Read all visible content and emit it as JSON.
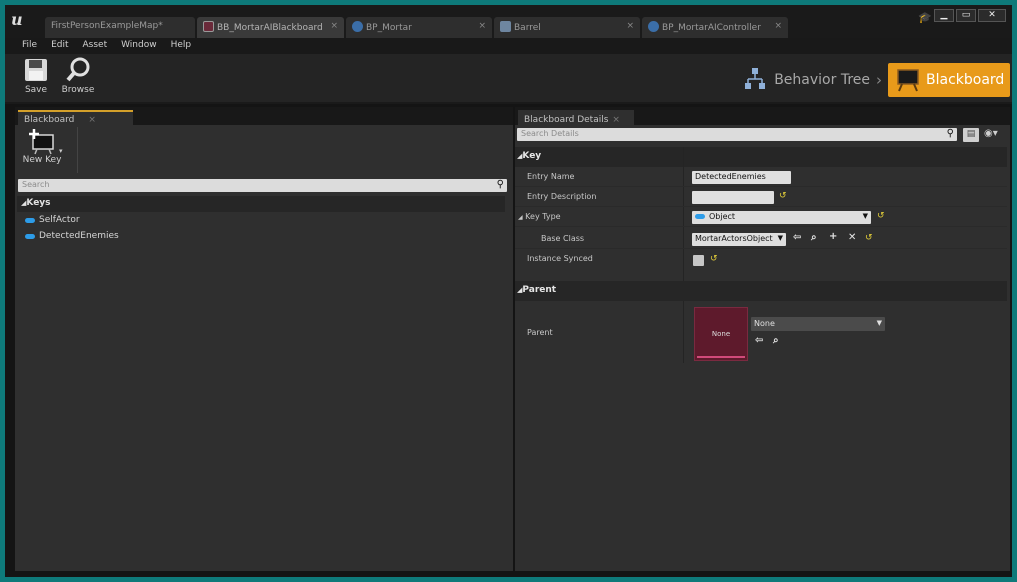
{
  "colors": {
    "accent": "#e89a1a",
    "window_border": "#0e7a7a",
    "key_pill": "#2d9ce8",
    "reset_arrow": "#e6d13a"
  },
  "titlebar": {
    "logo_icon": "unreal-engine-logo",
    "tabs": [
      {
        "label": "FirstPersonExampleMap",
        "dirty": "*",
        "icon": ""
      },
      {
        "label": "BB_MortarAIBlackboard",
        "icon": "blackboard-icon",
        "close": "×"
      },
      {
        "label": "BP_Mortar",
        "icon": "blueprint-icon",
        "close": "×"
      },
      {
        "label": "Barrel",
        "icon": "house-icon",
        "close": "×"
      },
      {
        "label": "BP_MortarAIController",
        "icon": "blueprint-icon",
        "close": "×"
      }
    ],
    "window_buttons": {
      "minimize": "▁",
      "maximize": "▭",
      "close": "✕"
    }
  },
  "menu": [
    "File",
    "Edit",
    "Asset",
    "Window",
    "Help"
  ],
  "toolbar": {
    "save_label": "Save",
    "browse_label": "Browse",
    "mode_behavior_tree": "Behavior Tree",
    "mode_separator": "›",
    "mode_blackboard": "Blackboard"
  },
  "left_panel": {
    "tab_label": "Blackboard",
    "tab_close": "×",
    "new_key_label": "New Key",
    "new_key_arrow": "▾",
    "search_placeholder": "Search",
    "category_label": "Keys",
    "collapse_glyph": "◢",
    "keys": [
      "SelfActor",
      "DetectedEnemies"
    ]
  },
  "right_panel": {
    "tab_label": "Blackboard Details",
    "tab_close": "×",
    "search_placeholder": "Search Details",
    "sections": {
      "key": "Key",
      "parent": "Parent"
    },
    "props": {
      "entry_name_label": "Entry Name",
      "entry_name_value": "DetectedEnemies",
      "entry_description_label": "Entry Description",
      "entry_description_value": "",
      "key_type_label": "Key Type",
      "key_type_value": "Object",
      "base_class_label": "Base Class",
      "base_class_value": "MortarActorsObject",
      "instance_synced_label": "Instance Synced",
      "parent_label": "Parent",
      "parent_thumb_text": "None",
      "parent_value": "None"
    },
    "glyphs": {
      "reset": "↺",
      "use": "⇦",
      "browse": "⌕",
      "add": "+",
      "clear": "✕",
      "dd": "▼",
      "eye": "◉▾",
      "grid": "▤"
    }
  }
}
